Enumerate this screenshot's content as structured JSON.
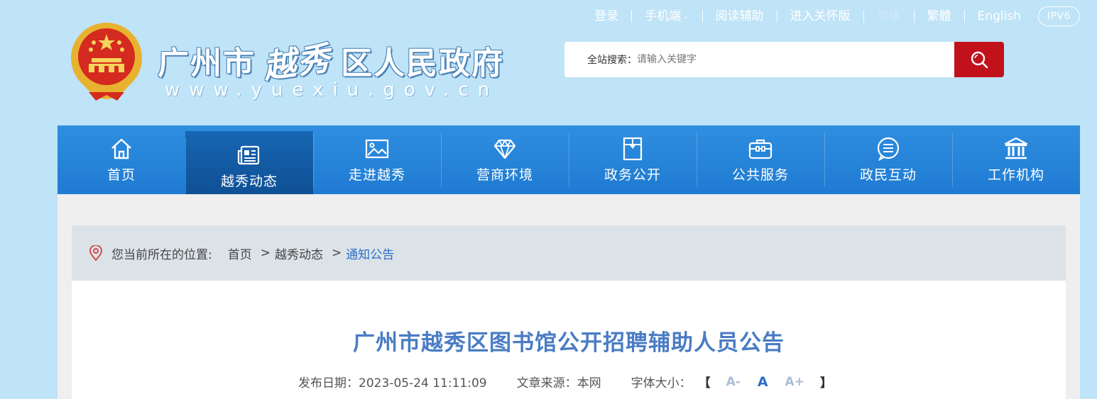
{
  "topbar": {
    "links": [
      "登录",
      "手机端",
      "阅读辅助",
      "进入关怀版",
      "简体",
      "繁體",
      "English"
    ],
    "ipv6": "IPV6"
  },
  "header": {
    "site_name_left": "广州市",
    "site_name_callig": "越秀",
    "site_name_right": "区人民政府",
    "site_url": "www.yuexiu.gov.cn"
  },
  "search": {
    "label": "全站搜索：",
    "placeholder": "请输入关键字"
  },
  "nav": {
    "items": [
      {
        "label": "首页",
        "icon": "home-icon"
      },
      {
        "label": "越秀动态",
        "icon": "newspaper-icon"
      },
      {
        "label": "走进越秀",
        "icon": "image-icon"
      },
      {
        "label": "营商环境",
        "icon": "diamond-icon"
      },
      {
        "label": "政务公开",
        "icon": "folder-icon"
      },
      {
        "label": "公共服务",
        "icon": "briefcase-icon"
      },
      {
        "label": "政民互动",
        "icon": "chat-icon"
      },
      {
        "label": "工作机构",
        "icon": "institution-icon"
      }
    ],
    "active_index": 1
  },
  "breadcrumb": {
    "prefix": "您当前所在的位置:",
    "items": [
      "首页",
      "越秀动态",
      "通知公告"
    ],
    "separator": ">"
  },
  "article": {
    "title": "广州市越秀区图书馆公开招聘辅助人员公告",
    "publish_date": "发布日期：2023-05-24 11:11:09",
    "source": "文章来源：本网",
    "font_size_label": "字体大小：",
    "font_size_open": "【",
    "font_size_close": "】",
    "font_small": "A-",
    "font_mid": "A",
    "font_large": "A+"
  },
  "colors": {
    "page_bg": "#bfe3f7",
    "nav_bg": "#2a87dc",
    "nav_active": "#0e4e92",
    "search_button": "#c1121c",
    "title_blue": "#4a7cc4"
  }
}
